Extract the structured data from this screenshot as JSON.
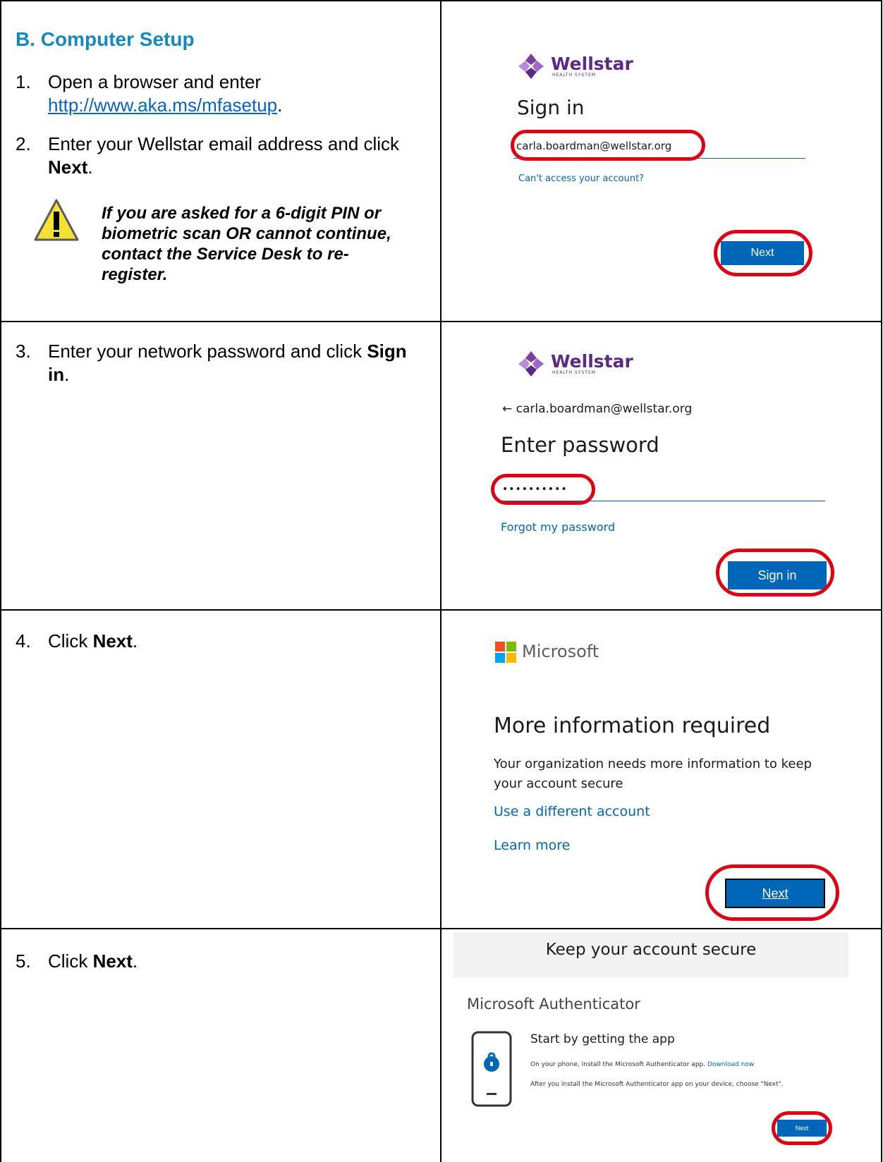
{
  "section_heading": "B.  Computer Setup",
  "steps": {
    "s1": {
      "num": "1.",
      "text": "Open a browser and enter",
      "link": "http://www.aka.ms/mfasetup",
      "after_link": "."
    },
    "s2": {
      "num": "2.",
      "text_a": "Enter your Wellstar email address and click ",
      "bold": "Next",
      "text_b": "."
    },
    "warning": "If you are asked for a 6-digit PIN or biometric scan OR cannot continue, contact the Service Desk to re-register.",
    "s3": {
      "num": "3.",
      "text_a": "Enter your network password and click ",
      "bold": "Sign in",
      "text_b": "."
    },
    "s4": {
      "num": "4.",
      "text_a": "Click ",
      "bold": "Next",
      "text_b": "."
    },
    "s5": {
      "num": "5.",
      "text_a": "Click ",
      "bold": "Next",
      "text_b": "."
    }
  },
  "panel1": {
    "logo_name": "Wellstar",
    "logo_sub": "HEALTH SYSTEM",
    "title": "Sign in",
    "email_value": "carla.boardman@wellstar.org",
    "cant_access": "Can't access your account?",
    "button": "Next"
  },
  "panel2": {
    "logo_name": "Wellstar",
    "logo_sub": "HEALTH SYSTEM",
    "back_email": "← carla.boardman@wellstar.org",
    "title": "Enter password",
    "password_value": "••••••••••",
    "forgot": "Forgot my password",
    "button": "Sign in"
  },
  "panel3": {
    "brand": "Microsoft",
    "title": "More information required",
    "body": "Your organization needs more information to keep your account secure",
    "link1": "Use a different account",
    "link2": "Learn more",
    "button": "Next"
  },
  "panel4": {
    "header": "Keep your account secure",
    "subtitle": "Microsoft Authenticator",
    "step_title": "Start by getting the app",
    "line1": "On your phone, install the Microsoft Authenticator app.",
    "download": "Download now",
    "line2": "After you install the Microsoft Authenticator app on your device, choose \"Next\".",
    "button": "Next"
  },
  "colors": {
    "heading": "#1588c4",
    "ring": "#e00012",
    "ms_blue": "#0067b8",
    "wellstar_purple": "#5b2a86"
  },
  "icons": [
    "warning-icon",
    "wellstar-logo-icon",
    "microsoft-logo-icon",
    "phone-lock-icon"
  ]
}
